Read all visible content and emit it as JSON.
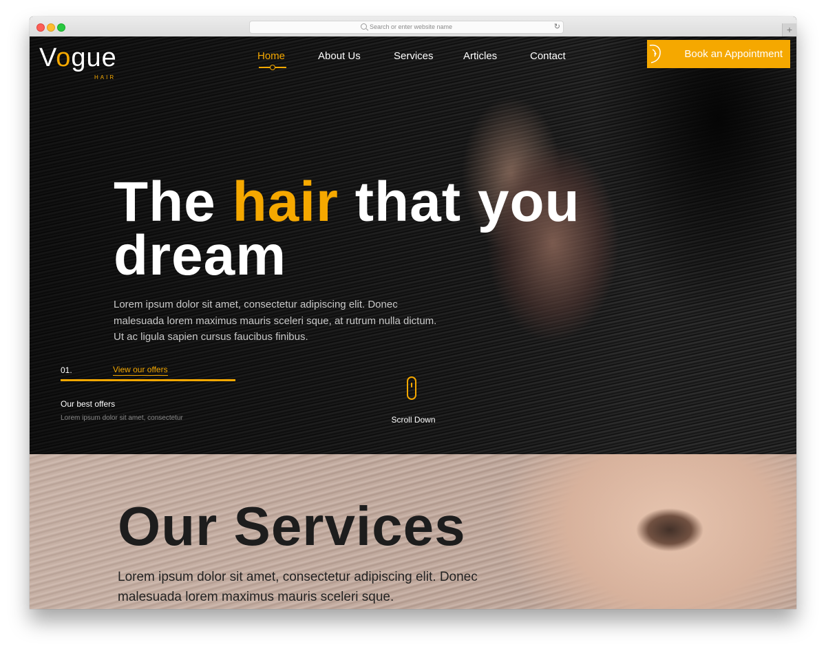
{
  "browser": {
    "url_placeholder": "Search or enter website name",
    "reload_glyph": "↻",
    "new_tab_glyph": "+"
  },
  "logo": {
    "word_prefix": "V",
    "word_o": "o",
    "word_suffix": "gue",
    "sub": "HAIR"
  },
  "nav": {
    "items": [
      {
        "label": "Home"
      },
      {
        "label": "About Us"
      },
      {
        "label": "Services"
      },
      {
        "label": "Articles"
      },
      {
        "label": "Contact"
      }
    ],
    "book_label": "Book an Appointment"
  },
  "hero": {
    "headline_pre": "The ",
    "headline_accent": "hair",
    "headline_post": " that you",
    "headline_line2": "dream",
    "paragraph_l1": "Lorem ipsum dolor sit amet, consectetur adipiscing elit. Donec",
    "paragraph_l2": "malesuada lorem maximus mauris sceleri sque, at rutrum nulla dictum.",
    "paragraph_l3": "Ut ac ligula sapien cursus faucibus finibus.",
    "offer_number": "01.",
    "offer_link": "View our offers",
    "offer_title": "Our best offers",
    "offer_subtitle": "Lorem ipsum dolor sit amet, consectetur",
    "scroll_label": "Scroll Down"
  },
  "services": {
    "title": "Our Services",
    "paragraph_l1": "Lorem ipsum dolor sit amet, consectetur adipiscing elit. Donec",
    "paragraph_l2": "malesuada lorem maximus mauris sceleri sque."
  },
  "colors": {
    "accent": "#f5a800",
    "hero_text": "#ffffff",
    "services_title": "#1d1d1d"
  }
}
